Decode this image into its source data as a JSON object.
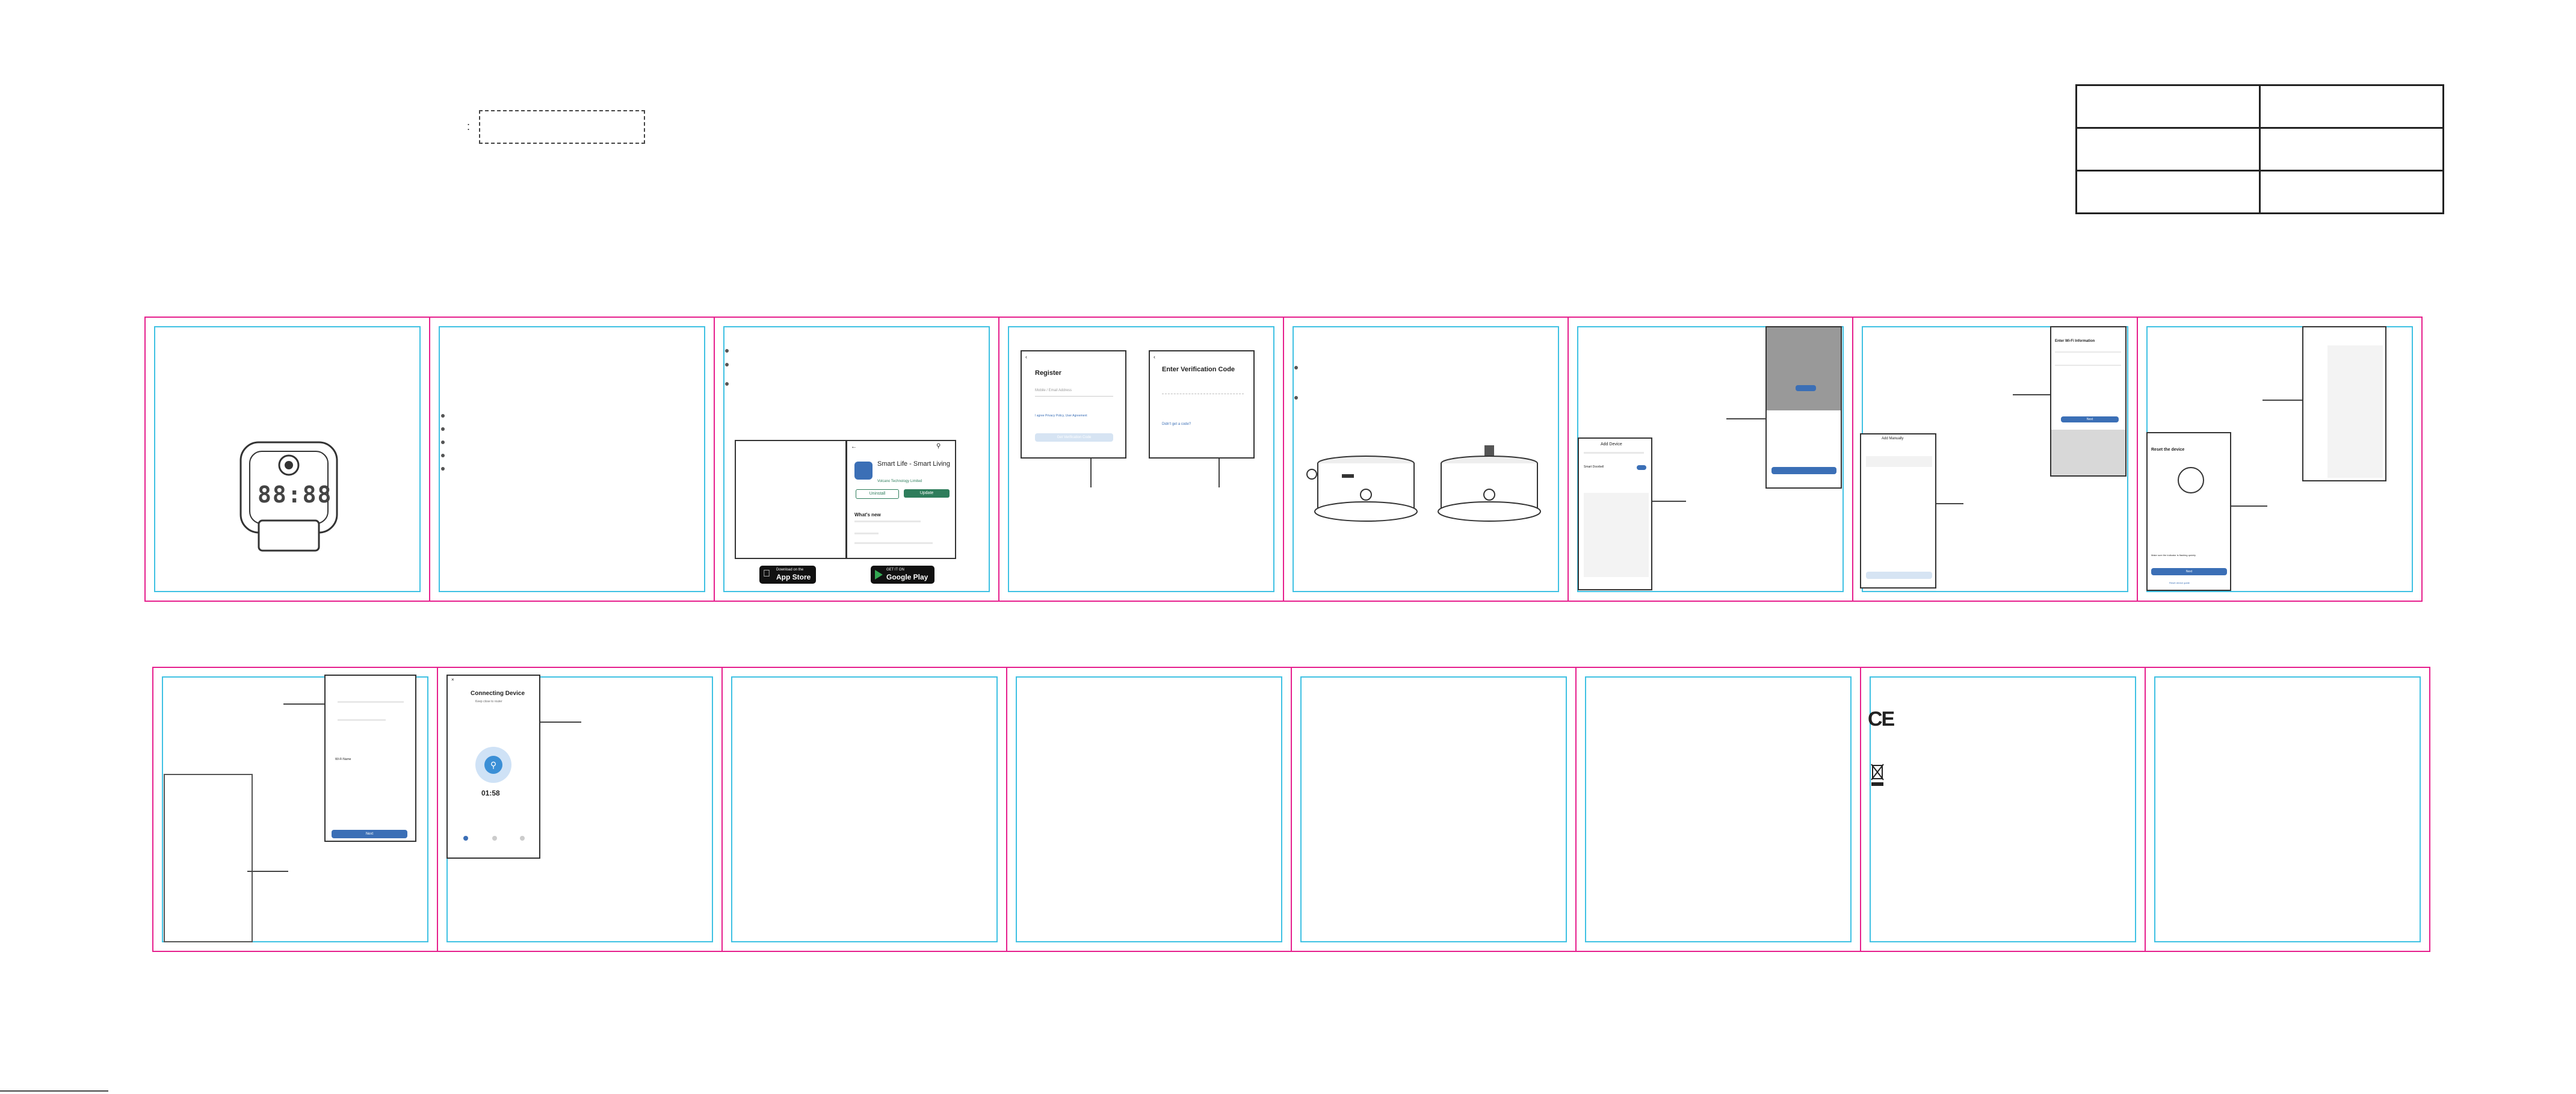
{
  "header": {
    "dashed_box_marker": ":"
  },
  "app_store": {
    "app_name": "Smart Life - Smart Living",
    "developer": "Volcano Technology Limited",
    "uninstall_label": "Uninstall",
    "update_label": "Update",
    "whats_new_label": "What's new",
    "apple_badge_small": "Download on the",
    "apple_badge_big": "App Store",
    "google_badge_small": "GET IT ON",
    "google_badge_big": "Google Play"
  },
  "register": {
    "title": "Register",
    "placeholder": "Mobile / Email Address",
    "agree_text": "I agree Privacy Policy, User Agreement",
    "button_label": "Get Verification Code"
  },
  "verify": {
    "title": "Enter Verification Code",
    "resend_text": "Didn't get a code?"
  },
  "screen_add": {
    "title": "Add Device",
    "item": "Smart Doorbell"
  },
  "screen_wifi": {
    "title": "Enter Wi-Fi Information",
    "next_label": "Next"
  },
  "screen_reset": {
    "title": "Reset the device",
    "confirm_text": "Make sure the indicator is flashing quickly",
    "next_label": "Next",
    "link_text": "Reset device guide"
  },
  "screen_device": {
    "title": "Add Manually"
  },
  "connecting": {
    "title": "Connecting Device",
    "subtitle": "Keep close to router",
    "timer": "01:58"
  },
  "screen_wifi2": {
    "item": "Wi-Fi Name",
    "next_label": "Next"
  },
  "clock_display": {
    "digits": "88:88"
  },
  "marks": {
    "ce": "CE"
  },
  "colors": {
    "panel_border": "#e61f8d",
    "inner_border": "#3fc1e3",
    "accent": "#3b6fb6",
    "play_green": "#2e7d5b"
  }
}
